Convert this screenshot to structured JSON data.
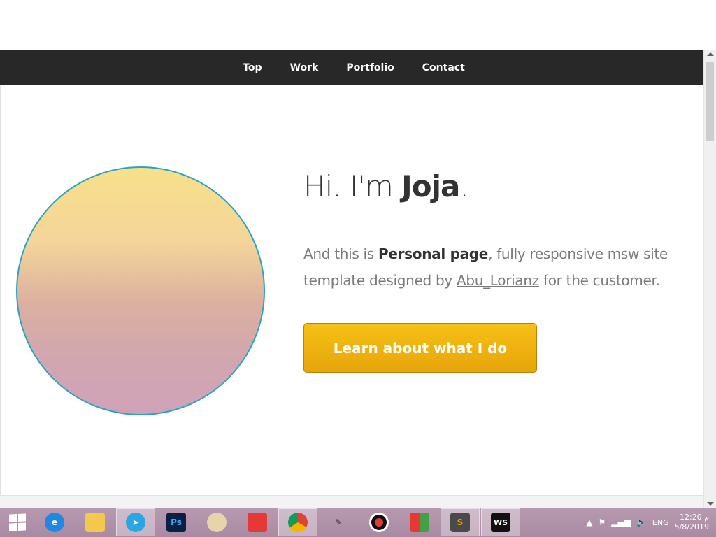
{
  "nav": {
    "items": [
      {
        "label": "Top"
      },
      {
        "label": "Work"
      },
      {
        "label": "Portfolio"
      },
      {
        "label": "Contact"
      }
    ]
  },
  "hero": {
    "greeting": "Hi. I'm ",
    "name": "Joja",
    "greeting_end": ".",
    "intro_part1": "And this is ",
    "intro_bold": "Personal page",
    "intro_part2": ", fully responsive msw site template designed by ",
    "author_link": "Abu_Lorianz",
    "intro_part3": " for the customer.",
    "cta_label": "Learn about what I do"
  },
  "colors": {
    "navbar": "#282828",
    "cta": "#f0b20f",
    "avatar_border": "#2aa4c4"
  },
  "taskbar": {
    "apps": [
      {
        "icon": "internet-explorer-icon"
      },
      {
        "icon": "file-explorer-icon"
      },
      {
        "icon": "telegram-icon"
      },
      {
        "icon": "photoshop-icon",
        "text": "Ps"
      },
      {
        "icon": "paint-palette-icon"
      },
      {
        "icon": "network-monitor-icon"
      },
      {
        "icon": "chrome-icon"
      },
      {
        "icon": "pen-tool-icon"
      },
      {
        "icon": "record-icon"
      },
      {
        "icon": "color-blocks-icon"
      },
      {
        "icon": "sublime-text-icon",
        "text": "S"
      },
      {
        "icon": "webstorm-icon",
        "text": "WS"
      }
    ],
    "tray": {
      "language": "ENG",
      "time": "12:20 م",
      "date": "5/8/2019"
    }
  }
}
